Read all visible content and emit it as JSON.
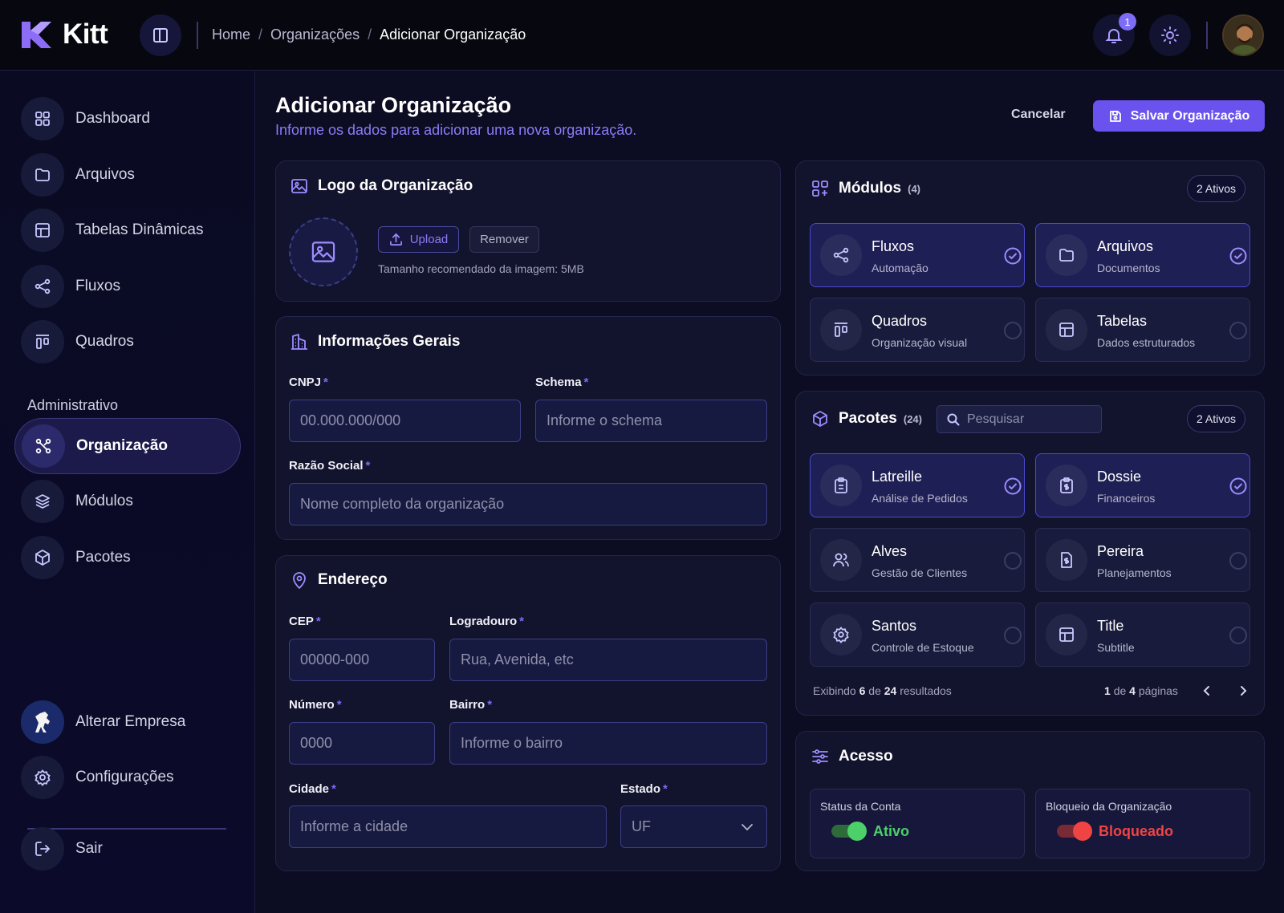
{
  "app": {
    "name": "Kitt"
  },
  "breadcrumb": [
    "Home",
    "Organizações",
    "Adicionar Organização"
  ],
  "breadcrumb_separator": "/",
  "notifications": {
    "count": "1"
  },
  "sidebar": {
    "items": [
      {
        "label": "Dashboard",
        "icon": "grid-icon"
      },
      {
        "label": "Arquivos",
        "icon": "folder-icon"
      },
      {
        "label": "Tabelas Dinâmicas",
        "icon": "table-icon"
      },
      {
        "label": "Fluxos",
        "icon": "share-icon"
      },
      {
        "label": "Quadros",
        "icon": "kanban-icon"
      }
    ],
    "section_label": "Administrativo",
    "admin_items": [
      {
        "label": "Organização",
        "icon": "network-icon",
        "active": true
      },
      {
        "label": "Módulos",
        "icon": "layers-icon"
      },
      {
        "label": "Pacotes",
        "icon": "package-icon"
      }
    ],
    "bottom": {
      "switch_company": "Alterar Empresa",
      "settings": "Configurações",
      "logout": "Sair"
    }
  },
  "page": {
    "title": "Adicionar Organização",
    "subtitle": "Informe os dados para adicionar uma nova organização.",
    "cancel_label": "Cancelar",
    "save_label": "Salvar Organização"
  },
  "logo_card": {
    "title": "Logo da Organização",
    "upload_label": "Upload",
    "remove_label": "Remover",
    "hint": "Tamanho recomendado da imagem: 5MB"
  },
  "general_card": {
    "title": "Informações Gerais",
    "cnpj": {
      "label": "CNPJ",
      "placeholder": "00.000.000/000"
    },
    "schema": {
      "label": "Schema",
      "placeholder": "Informe o schema"
    },
    "razao": {
      "label": "Razão Social",
      "placeholder": "Nome completo da organização"
    }
  },
  "address_card": {
    "title": "Endereço",
    "cep": {
      "label": "CEP",
      "placeholder": "00000-000"
    },
    "logradouro": {
      "label": "Logradouro",
      "placeholder": "Rua, Avenida, etc"
    },
    "numero": {
      "label": "Número",
      "placeholder": "0000"
    },
    "bairro": {
      "label": "Bairro",
      "placeholder": "Informe o bairro"
    },
    "cidade": {
      "label": "Cidade",
      "placeholder": "Informe a cidade"
    },
    "estado": {
      "label": "Estado",
      "placeholder": "UF"
    }
  },
  "required_mark": "*",
  "modules_card": {
    "title": "Módulos",
    "count": "(4)",
    "active_badge": "2 Ativos",
    "tiles": [
      {
        "title": "Fluxos",
        "subtitle": "Automação",
        "selected": true
      },
      {
        "title": "Arquivos",
        "subtitle": "Documentos",
        "selected": true
      },
      {
        "title": "Quadros",
        "subtitle": "Organização visual",
        "selected": false
      },
      {
        "title": "Tabelas",
        "subtitle": "Dados estruturados",
        "selected": false
      }
    ]
  },
  "packages_card": {
    "title": "Pacotes",
    "count": "(24)",
    "search_placeholder": "Pesquisar",
    "active_badge": "2 Ativos",
    "tiles": [
      {
        "title": "Latreille",
        "subtitle": "Análise de Pedidos",
        "selected": true
      },
      {
        "title": "Dossie",
        "subtitle": "Financeiros",
        "selected": true
      },
      {
        "title": "Alves",
        "subtitle": "Gestão de Clientes",
        "selected": false
      },
      {
        "title": "Pereira",
        "subtitle": "Planejamentos",
        "selected": false
      },
      {
        "title": "Santos",
        "subtitle": "Controle de Estoque",
        "selected": false
      },
      {
        "title": "Title",
        "subtitle": "Subtitle",
        "selected": false
      }
    ],
    "footer": {
      "showing_prefix": "Exibindo",
      "shown": "6",
      "of_word": "de",
      "total": "24",
      "results_word": "resultados",
      "page_current": "1",
      "page_of": "de",
      "page_total": "4",
      "pages_word": "páginas"
    }
  },
  "access_card": {
    "title": "Acesso",
    "account_status": {
      "label": "Status da Conta",
      "value": "Ativo",
      "on": true
    },
    "org_block": {
      "label": "Bloqueio da Organização",
      "value": "Bloqueado",
      "on": true
    }
  },
  "colors": {
    "accent": "#6a52ee",
    "active_green": "#4cd06a",
    "blocked_red": "#ef4444"
  }
}
